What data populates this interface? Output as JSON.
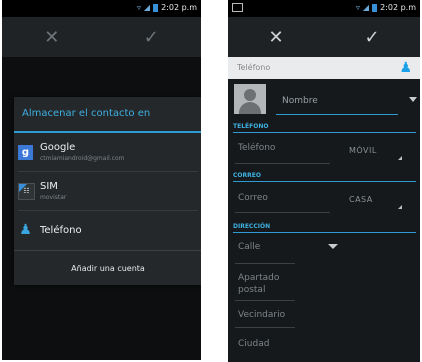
{
  "left": {
    "status": {
      "time": "2:02 p.m"
    },
    "actionbar": {
      "cancel_icon": "close-icon",
      "done_icon": "check-icon"
    },
    "dialog": {
      "title": "Almacenar el contacto en",
      "items": [
        {
          "label": "Google",
          "sub": "ctmiamiandroid@gmail.com",
          "icon": "google-plus-icon"
        },
        {
          "label": "SIM",
          "sub": "movistar",
          "icon": "sim-icon"
        },
        {
          "label": "Teléfono",
          "sub": "",
          "icon": "person-icon"
        }
      ],
      "footer": "Añadir una cuenta"
    }
  },
  "right": {
    "status": {
      "time": "2:02 p.m"
    },
    "actionbar": {
      "cancel_icon": "close-icon",
      "done_icon": "check-icon"
    },
    "account_type": "Teléfono",
    "name_placeholder": "Nombre",
    "sections": {
      "phone": "TELÉFONO",
      "email": "CORREO",
      "address": "DIRECCIÓN"
    },
    "fields": {
      "phone": {
        "label": "Teléfono",
        "type": "MÓVIL"
      },
      "email": {
        "label": "Correo",
        "type": "CASA"
      },
      "street": "Calle",
      "po_box": "Apartado postal",
      "neighborhood": "Vecindario",
      "city": "Ciudad"
    }
  },
  "colors": {
    "accent": "#2f9bd3",
    "background": "#15191b"
  }
}
